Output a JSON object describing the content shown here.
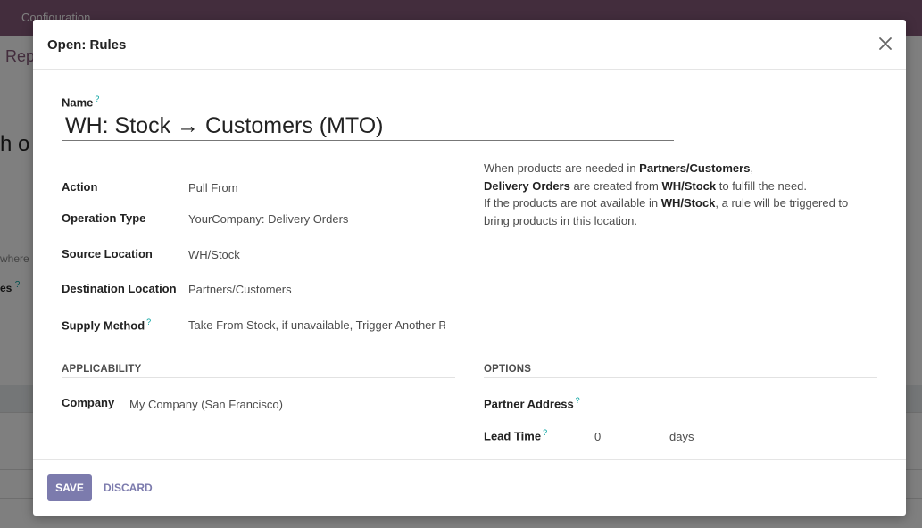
{
  "background": {
    "navbar_menu": "Configuration",
    "breadcrumb": "Rep",
    "sheet_title": "h o",
    "hint": "where",
    "label_text": "es"
  },
  "modal": {
    "title": "Open: Rules",
    "close_icon": "close-icon"
  },
  "form": {
    "name_label": "Name",
    "name_value": "WH: Stock → Customers (MTO)",
    "action_label": "Action",
    "action_value": "Pull From",
    "operation_type_label": "Operation Type",
    "operation_type_value": "YourCompany: Delivery Orders",
    "source_location_label": "Source Location",
    "source_location_value": "WH/Stock",
    "destination_location_label": "Destination Location",
    "destination_location_value": "Partners/Customers",
    "supply_method_label": "Supply Method",
    "supply_method_value": "Take From Stock, if unavailable, Trigger Another Ru",
    "help_marker": "?"
  },
  "description": {
    "line1_pre": "When products are needed in ",
    "line1_bold": "Partners/Customers",
    "line1_post": ",",
    "line2_bold": "Delivery Orders",
    "line2_mid": " are created from ",
    "line2_bold2": "WH/Stock",
    "line2_post": " to fulfill the need.",
    "line3_pre": "If the products are not available in ",
    "line3_bold": "WH/Stock",
    "line3_post": ", a rule will be triggered to bring products in this location."
  },
  "applicability": {
    "section_title": "APPLICABILITY",
    "company_label": "Company",
    "company_value": "My Company (San Francisco)"
  },
  "options": {
    "section_title": "OPTIONS",
    "partner_address_label": "Partner Address",
    "lead_time_label": "Lead Time",
    "lead_time_value": "0",
    "lead_time_unit": "days"
  },
  "footer": {
    "save_label": "SAVE",
    "discard_label": "DISCARD"
  },
  "colors": {
    "navbar": "#875a7b",
    "primary_button": "#7c7bad",
    "help_marker": "#00a09d"
  }
}
